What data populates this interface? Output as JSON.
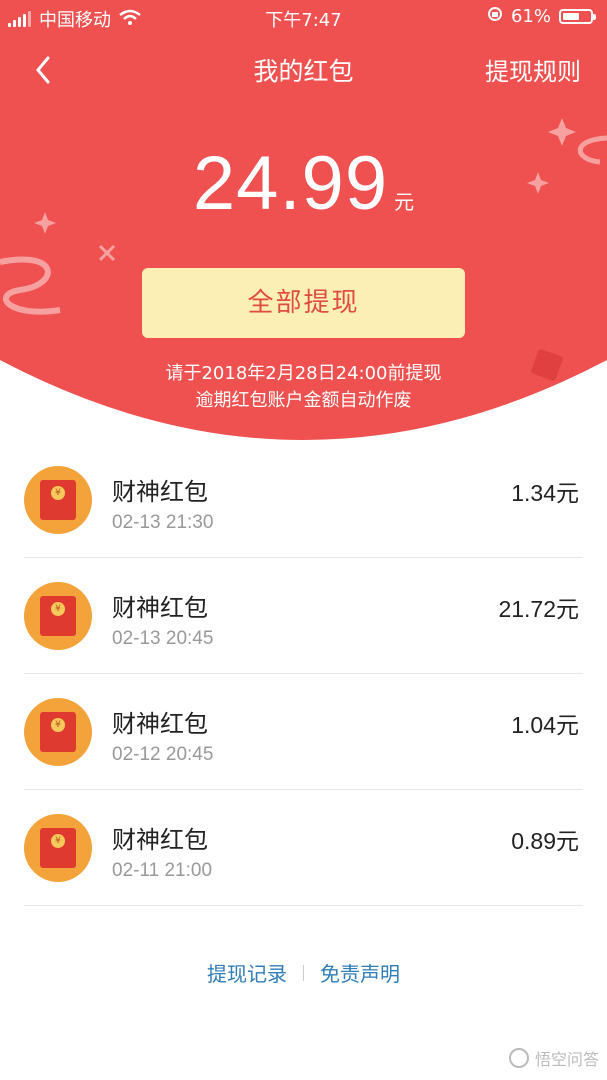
{
  "status_bar": {
    "carrier": "中国移动",
    "time": "下午7:47",
    "battery": "61%",
    "battery_level": 0.61
  },
  "nav": {
    "title": "我的红包",
    "rules": "提现规则"
  },
  "balance": {
    "amount": "24.99",
    "unit": "元"
  },
  "withdraw_button": "全部提现",
  "notice": {
    "line1": "请于2018年2月28日24:00前提现",
    "line2": "逾期红包账户金额自动作废"
  },
  "items": [
    {
      "title": "财神红包",
      "time": "02-13 21:30",
      "amount": "1.34",
      "unit": "元"
    },
    {
      "title": "财神红包",
      "time": "02-13 20:45",
      "amount": "21.72",
      "unit": "元"
    },
    {
      "title": "财神红包",
      "time": "02-12 20:45",
      "amount": "1.04",
      "unit": "元"
    },
    {
      "title": "财神红包",
      "time": "02-11 21:00",
      "amount": "0.89",
      "unit": "元"
    }
  ],
  "footer": {
    "records": "提现记录",
    "disclaimer": "免责声明"
  },
  "watermark": "悟空问答",
  "colors": {
    "header_red": "#ef5050",
    "button_yellow": "#fbefb6",
    "button_text": "#e04b42",
    "link_blue": "#2f7db9",
    "icon_orange": "#f3a33a"
  }
}
